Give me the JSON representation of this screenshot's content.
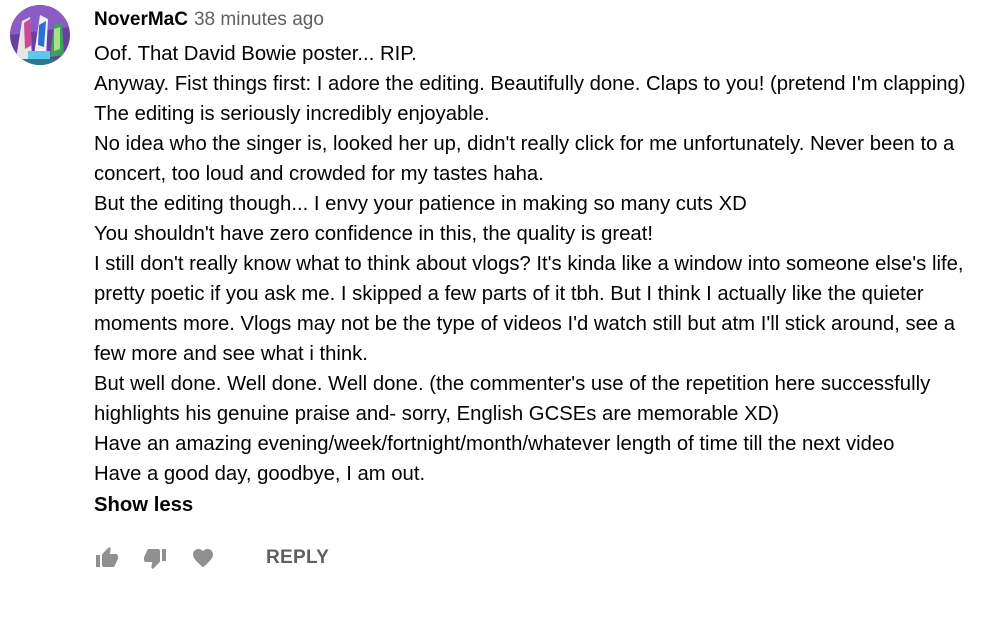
{
  "comment": {
    "author": "NoverMaC",
    "timestamp": "38 minutes ago",
    "lines": [
      "Oof. That David Bowie poster... RIP.",
      "Anyway. Fist things first: I adore the editing. Beautifully done. Claps to you! (pretend I'm clapping)",
      "The editing is seriously incredibly enjoyable.",
      "No idea who the singer is, looked her up, didn't really click for me unfortunately. Never been to a concert, too loud and crowded for my tastes haha.",
      "But the editing though... I envy your patience in making so many cuts XD",
      "You shouldn't have zero confidence in this, the quality is great!",
      "I still don't really know what to think about vlogs? It's kinda like a window into someone else's life, pretty poetic if you ask me. I skipped a few parts of it tbh. But I think I actually like the quieter moments more. Vlogs may not be the type of videos I'd watch still but atm I'll stick around, see a few more and see what i think.",
      "But well done. Well done. Well done. (the commenter's use of the repetition here successfully highlights his genuine praise and- sorry, English GCSEs are memorable XD)",
      "Have an amazing evening/week/fortnight/month/whatever length of time till the next video",
      "Have a good day, goodbye, I am out."
    ],
    "show_less_label": "Show less",
    "reply_label": "REPLY"
  },
  "icons": {
    "like": "thumbs-up-icon",
    "dislike": "thumbs-down-icon",
    "heart": "heart-icon"
  },
  "colors": {
    "text": "#030303",
    "secondary": "#606060",
    "icon": "#909090"
  }
}
